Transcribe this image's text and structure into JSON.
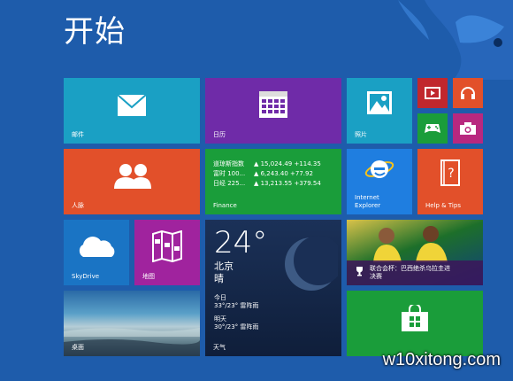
{
  "header": {
    "title": "开始"
  },
  "tiles": {
    "mail": {
      "label": "邮件",
      "color": "#1aa0c4"
    },
    "calendar": {
      "label": "日历",
      "color": "#6f2ba8"
    },
    "photos": {
      "label": "照片",
      "color": "#1aa0c4"
    },
    "video": {
      "color": "#c1272d"
    },
    "music": {
      "color": "#e2502a"
    },
    "games": {
      "color": "#1a9d3a"
    },
    "camera": {
      "color": "#b8287f"
    },
    "people": {
      "label": "人脉",
      "color": "#e2502a"
    },
    "finance": {
      "label": "Finance",
      "color": "#1a9d3a",
      "rows": [
        {
          "name": "道琼斯指数",
          "value": "▲ 15,024.49 +114.35"
        },
        {
          "name": "富时 100...",
          "value": "▲ 6,243.40 +77.92"
        },
        {
          "name": "日经 225...",
          "value": "▲ 13,213.55 +379.54"
        }
      ]
    },
    "ie": {
      "label": "Internet Explorer",
      "line1": "Internet",
      "line2": "Explorer",
      "color": "#1f7ee0"
    },
    "help": {
      "label": "Help & Tips",
      "color": "#e2502a"
    },
    "skydrive": {
      "label": "SkyDrive",
      "color": "#1a74c4"
    },
    "maps": {
      "label": "地图",
      "color": "#a0239e"
    },
    "weather": {
      "label": "天气",
      "temp": "24°",
      "city": "北京",
      "condition": "晴",
      "today_label": "今日",
      "today_value": "33°/23° 雷阵雨",
      "tomorrow_label": "明天",
      "tomorrow_value": "30°/23° 雷阵雨",
      "color": "#14294d"
    },
    "news": {
      "caption": "联合会杯：巴西绝杀乌拉圭进决赛",
      "line1": "联合会杯：巴西绝杀乌拉圭进",
      "line2": "决赛"
    },
    "desktop": {
      "label": "桌面"
    },
    "store": {
      "color": "#1a9d3a"
    }
  },
  "watermark": "w10xitong.com"
}
